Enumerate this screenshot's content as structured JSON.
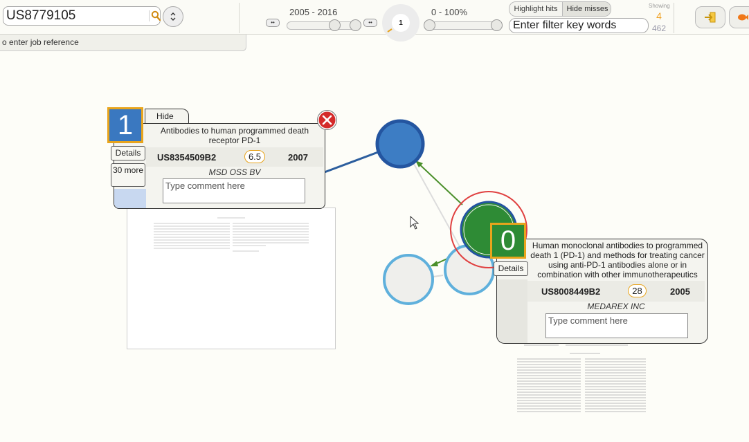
{
  "toolbar": {
    "search_value": "US8779105",
    "year_range": "2005 - 2016",
    "score_range": "0 - 100%",
    "gauge_value": "1",
    "small_btn": "••",
    "highlight_hits": "Highlight hits",
    "hide_misses": "Hide misses",
    "filter_placeholder": "Enter filter key words",
    "showing_label": "Showing",
    "showing_count": "4",
    "showing_total": "462"
  },
  "job_ref": {
    "text": "o enter job reference"
  },
  "cards": [
    {
      "number": "1",
      "hide_label": "Hide",
      "title": "Antibodies to human programmed death receptor PD-1",
      "patent": "US8354509B2",
      "score": "6.5",
      "year": "2007",
      "assignee": "MSD OSS BV",
      "comment_placeholder": "Type comment here",
      "details_label": "Details",
      "more_label": "30 more"
    },
    {
      "number": "0",
      "title": "Human monoclonal antibodies to programmed death 1 (PD-1) and methods for treating cancer using anti-PD-1 antibodies alone or in combination with other immunotherapeutics",
      "patent": "US8008449B2",
      "score": "28",
      "year": "2005",
      "assignee": "MEDAREX INC",
      "comment_placeholder": "Type comment here",
      "details_label": "Details"
    }
  ],
  "colors": {
    "node_blue": "#3a78c0",
    "node_green": "#2e8b35",
    "accent_orange": "#e8a41c",
    "node_light": "#5fb0dc"
  }
}
